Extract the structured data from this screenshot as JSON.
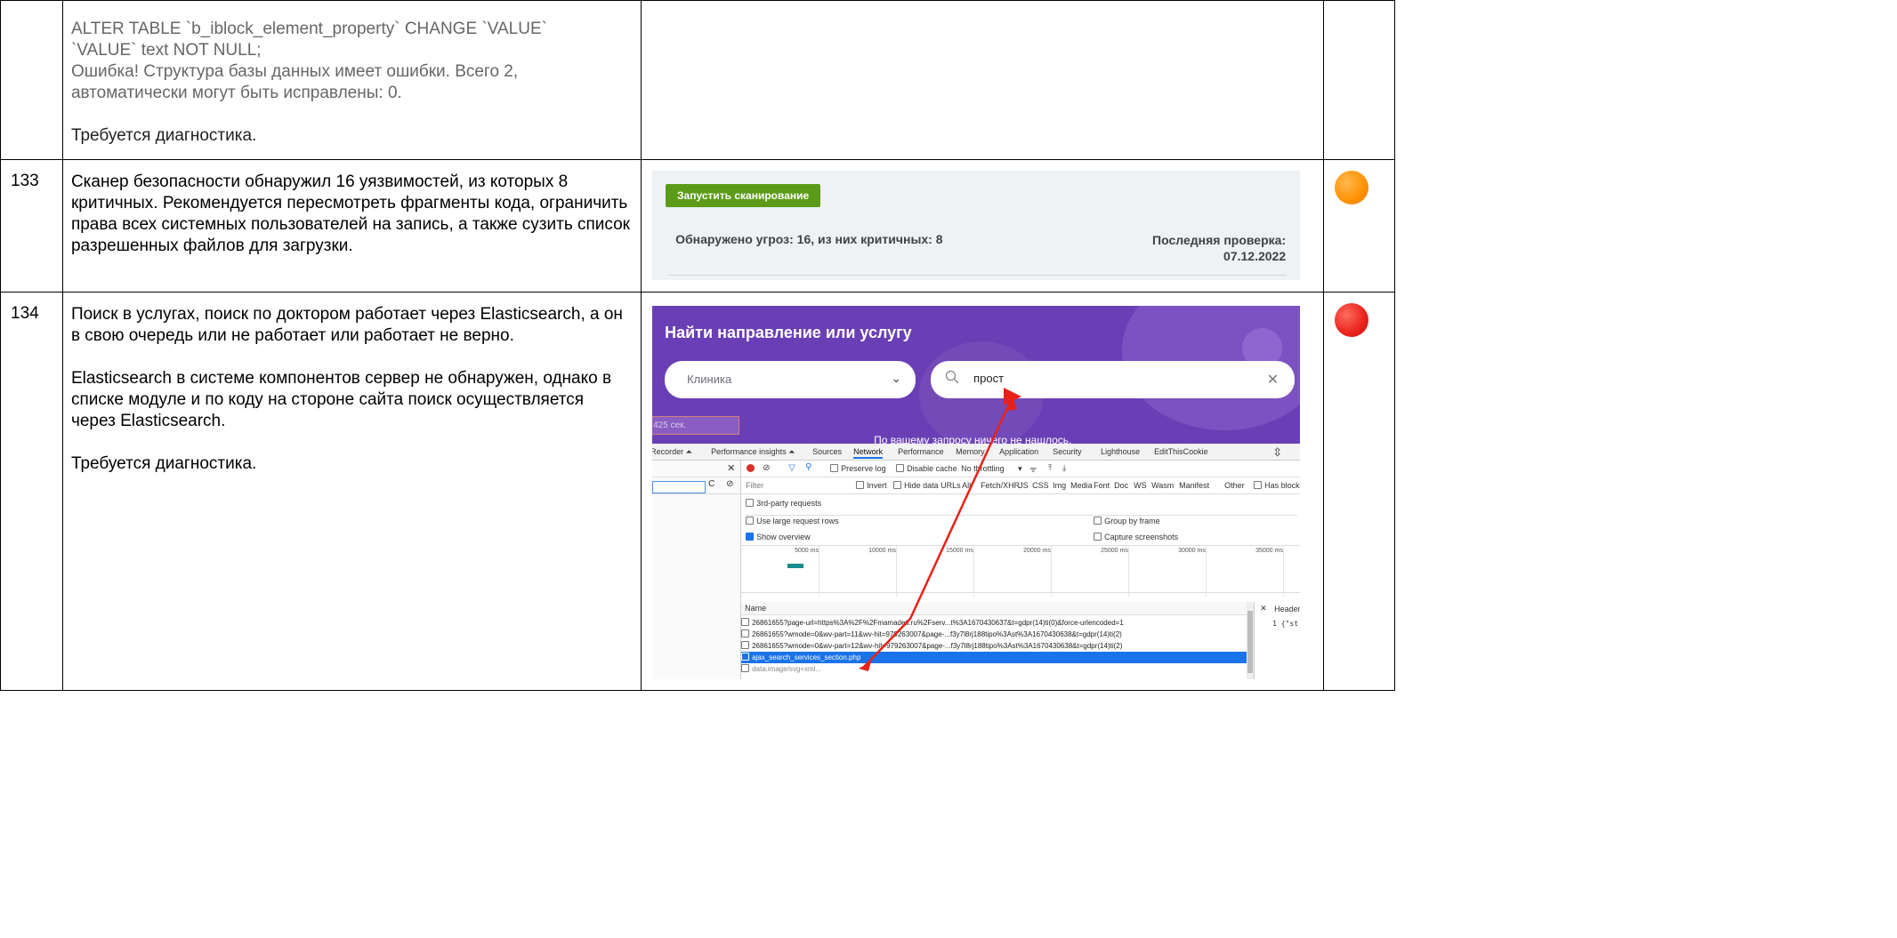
{
  "rows": [
    {
      "number": "",
      "lines": [
        "ALTER TABLE `b_iblock_element_property` CHANGE `VALUE`",
        "`VALUE` text NOT NULL;",
        "Ошибка! Структура базы данных имеет ошибки. Всего 2,",
        "автоматически могут быть исправлены: 0."
      ],
      "note": "Требуется диагностика."
    },
    {
      "number": "133",
      "text": "Сканер безопасности обнаружил 16 уязвимостей, из которых 8 критичных. Рекомендуется пересмотреть фрагменты кода, ограничить права всех системных пользователей на запись, а также сузить список разрешенных файлов для загрузки.",
      "status_color": "#ff9100"
    },
    {
      "number": "134",
      "para1": "Поиск в услугах, поиск по доктором работает через Elasticsearch, а он в свою очередь или не работает или работает не верно.",
      "para2": "Elasticsearch в системе компонентов сервер не обнаружен, однако в списке модуле и по коду на стороне сайта поиск осуществляется через Elasticsearch.",
      "note": "Требуется диагностика.",
      "status_color": "#e8221a"
    }
  ],
  "scan_panel": {
    "button_label": "Запустить сканирование",
    "found_text": "Обнаружено угроз: 16, из них критичных: 8",
    "last_check_label": "Последняя проверка:",
    "last_check_date": "07.12.2022",
    "button_color": "#5c9b17"
  },
  "search_screenshot": {
    "hero_title": "Найти направление или услугу",
    "clinic_placeholder": "Клиника",
    "search_value": "прост",
    "time_fragment": "425 сек.",
    "no_results": "По вашему запросу ничего не нашлось.",
    "hero_color": "#6a3fb5"
  },
  "devtools": {
    "tabs": [
      "Recorder ⏶",
      "Performance insights ⏶",
      "Sources",
      "Network",
      "Performance",
      "Memory",
      "Application",
      "Security",
      "Lighthouse",
      "EditThisCookie"
    ],
    "active_tab": "Network",
    "toolbar": {
      "preserve_log": "Preserve log",
      "disable_cache": "Disable cache",
      "throttling": "No throttling"
    },
    "filter": {
      "placeholder": "Filter",
      "invert": "Invert",
      "hide_data_urls": "Hide data URLs",
      "types": [
        "All",
        "Fetch/XHR",
        "JS",
        "CSS",
        "Img",
        "Media",
        "Font",
        "Doc",
        "WS",
        "Wasm",
        "Manifest",
        "Other"
      ],
      "has_blocked": "Has blocke"
    },
    "third_party": "3rd-party requests",
    "options": {
      "large_rows": "Use large request rows",
      "group_by_frame": "Group by frame",
      "show_overview": "Show overview",
      "capture_screenshots": "Capture screenshots"
    },
    "timeline_ticks": [
      "5000 ms",
      "10000 ms",
      "15000 ms",
      "20000 ms",
      "25000 ms",
      "30000 ms",
      "35000 ms"
    ],
    "name_header": "Name",
    "requests": [
      "26861655?page-url=https%3A%2F%2Fmamadeti.ru%2Fserv...t%3A1670430637&t=gdpr(14)ti(0)&force-urlencoded=1",
      "26861655?wmode=0&wv-part=11&wv-hit=979263007&page-...f3y7l8rj188tipo%3Ast%3A1670430638&t=gdpr(14)ti(2)",
      "26861655?wmode=0&wv-part=12&wv-hit=979263007&page-...f3y7l8rj188tipo%3Ast%3A1670430638&t=gdpr(14)ti(2)",
      "ajax_search_services_section.php",
      "data:image/svg+xml..."
    ],
    "selected_request": 3,
    "headers_label": "Headers",
    "preview_line": "1  {\"st"
  }
}
